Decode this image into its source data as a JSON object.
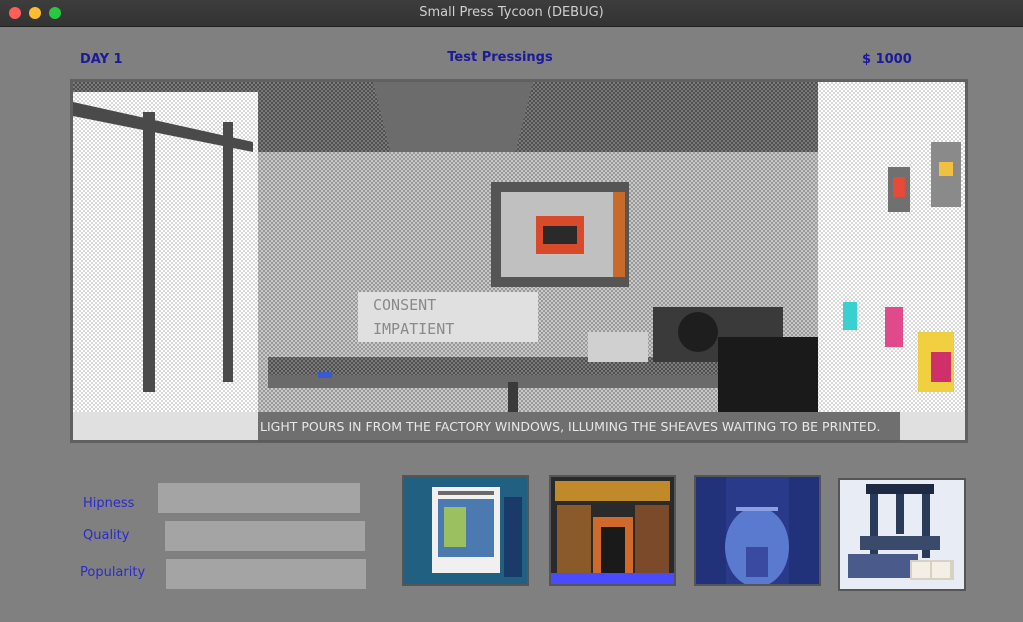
{
  "window": {
    "title": "Small Press Tycoon (DEBUG)"
  },
  "hud": {
    "day": "DAY 1",
    "location": "Test Pressings",
    "money": "$ 1000"
  },
  "scene": {
    "caption": "LIGHT POURS IN FROM THE FACTORY WINDOWS, ILLUMING THE SHEAVES WAITING TO BE PRINTED."
  },
  "stats": [
    {
      "label": "Hipness",
      "value": 0
    },
    {
      "label": "Quality",
      "value": 0
    },
    {
      "label": "Popularity",
      "value": 0
    }
  ],
  "cards": [
    {
      "icon": "book-card-icon"
    },
    {
      "icon": "bookshop-card-icon"
    },
    {
      "icon": "stage-card-icon"
    },
    {
      "icon": "printing-press-card-icon"
    }
  ],
  "colors": {
    "hud_text": "#1a1a9a",
    "stat_label": "#2a2ad0",
    "bar": "#a4a4a4",
    "background": "#808080"
  }
}
